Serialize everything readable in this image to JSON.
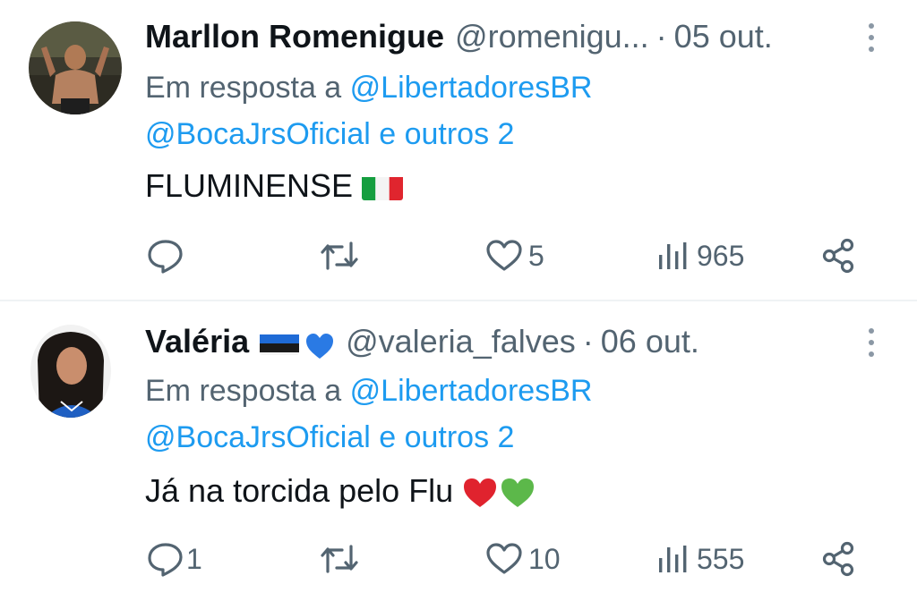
{
  "tweets": [
    {
      "name": "Marllon Romenigue",
      "handle": "@romenigu...",
      "separator": "·",
      "date": "05 out.",
      "reply_prefix": "Em resposta a",
      "reply_to": "@LibertadoresBR",
      "reply_others": "@BocaJrsOficial e outros 2",
      "text": "FLUMINENSE",
      "text_emoji": "italy-flag",
      "stats": {
        "replies": "",
        "retweets": "",
        "likes": "5",
        "views": "965"
      }
    },
    {
      "name": "Valéria",
      "name_emoji": [
        "estonia-flag",
        "blue-heart"
      ],
      "handle": "@valeria_falves",
      "separator": "·",
      "date": "06 out.",
      "reply_prefix": "Em resposta a",
      "reply_to": "@LibertadoresBR",
      "reply_others": "@BocaJrsOficial e outros 2",
      "text": "Já na torcida pelo Flu",
      "text_emoji": [
        "red-heart",
        "green-heart"
      ],
      "stats": {
        "replies": "1",
        "retweets": "",
        "likes": "10",
        "views": "555"
      }
    }
  ],
  "colors": {
    "link": "#1d9bf0",
    "muted": "#536471",
    "text": "#0f1419",
    "divider": "#eff3f4"
  }
}
